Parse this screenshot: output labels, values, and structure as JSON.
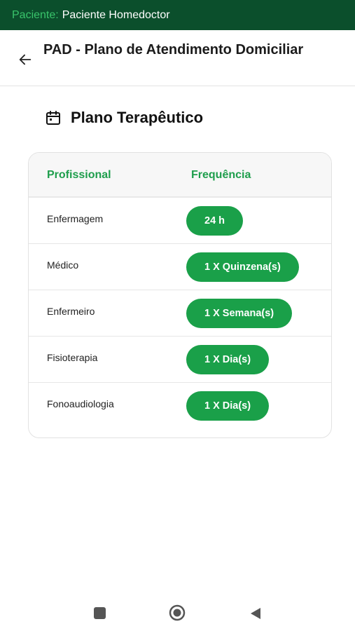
{
  "status_bar": {
    "label": "Paciente:",
    "value": "Paciente Homedoctor"
  },
  "header": {
    "title": "PAD - Plano de Atendimento Domiciliar"
  },
  "section": {
    "title": "Plano Terapêutico",
    "icon": "calendar-icon"
  },
  "table": {
    "headers": {
      "professional": "Profissional",
      "frequency": "Frequência"
    },
    "rows": [
      {
        "professional": "Enfermagem",
        "frequency": "24 h"
      },
      {
        "professional": "Médico",
        "frequency": "1 X Quinzena(s)"
      },
      {
        "professional": "Enfermeiro",
        "frequency": "1 X Semana(s)"
      },
      {
        "professional": "Fisioterapia",
        "frequency": "1 X Dia(s)"
      },
      {
        "professional": "Fonoaudiologia",
        "frequency": "1 X Dia(s)"
      }
    ]
  },
  "colors": {
    "status_bar": "#0b4f2c",
    "accent": "#1aa049",
    "header_text": "#1e9e4c"
  }
}
